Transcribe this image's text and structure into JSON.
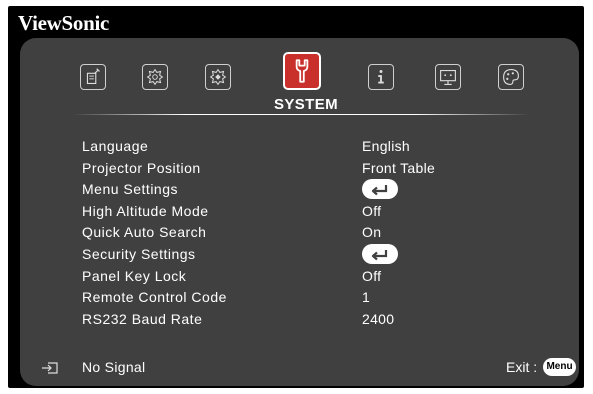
{
  "brand": "ViewSonic",
  "section_title": "SYSTEM",
  "tabs": [
    {
      "icon": "display-adjust-icon"
    },
    {
      "icon": "picture-settings-icon"
    },
    {
      "icon": "advanced-settings-icon"
    },
    {
      "icon": "system-wrench-icon",
      "active": true
    },
    {
      "icon": "information-icon"
    },
    {
      "icon": "screen-icon"
    },
    {
      "icon": "palette-icon"
    }
  ],
  "rows": [
    {
      "label": "Language",
      "value": "English"
    },
    {
      "label": "Projector Position",
      "value": "Front Table"
    },
    {
      "label": "Menu Settings",
      "value": "enter-icon"
    },
    {
      "label": "High Altitude Mode",
      "value": "Off"
    },
    {
      "label": "Quick Auto Search",
      "value": "On"
    },
    {
      "label": "Security Settings",
      "value": "enter-icon"
    },
    {
      "label": "Panel Key Lock",
      "value": "Off"
    },
    {
      "label": "Remote Control Code",
      "value": "1"
    },
    {
      "label": "RS232 Baud Rate",
      "value": "2400"
    }
  ],
  "footer": {
    "source_icon": "input-source-icon",
    "signal": "No Signal",
    "exit_label": "Exit :",
    "menu_button": "Menu"
  },
  "colors": {
    "panel": "#404040",
    "active_tab": "#c9302c",
    "text": "#ffffff",
    "background": "#000000"
  }
}
